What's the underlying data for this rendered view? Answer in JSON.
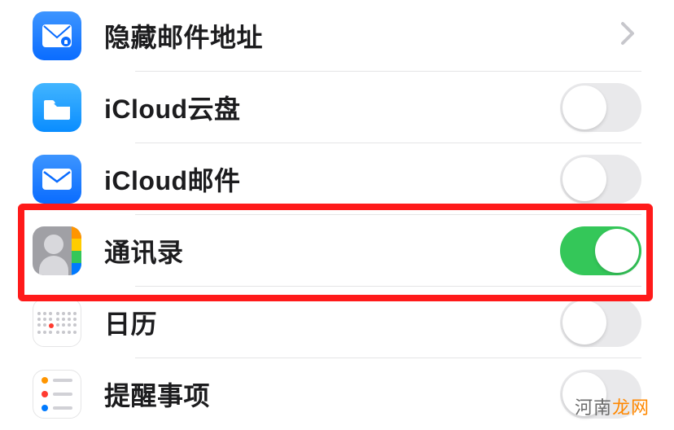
{
  "rows": [
    {
      "id": "hide-my-email",
      "label": "隐藏邮件地址",
      "control": "chevron"
    },
    {
      "id": "icloud-drive",
      "label": "iCloud云盘",
      "control": "toggle",
      "state": "off"
    },
    {
      "id": "icloud-mail",
      "label": "iCloud邮件",
      "control": "toggle",
      "state": "off"
    },
    {
      "id": "contacts",
      "label": "通讯录",
      "control": "toggle",
      "state": "on",
      "highlighted": true
    },
    {
      "id": "calendar",
      "label": "日历",
      "control": "toggle",
      "state": "off"
    },
    {
      "id": "reminders",
      "label": "提醒事项",
      "control": "toggle",
      "state": "off"
    }
  ],
  "watermark": {
    "part1": "河南",
    "part2": "龙网"
  },
  "colors": {
    "toggle_on": "#34c759",
    "toggle_off": "#e9e9eb",
    "highlight": "#ff1a1a"
  }
}
